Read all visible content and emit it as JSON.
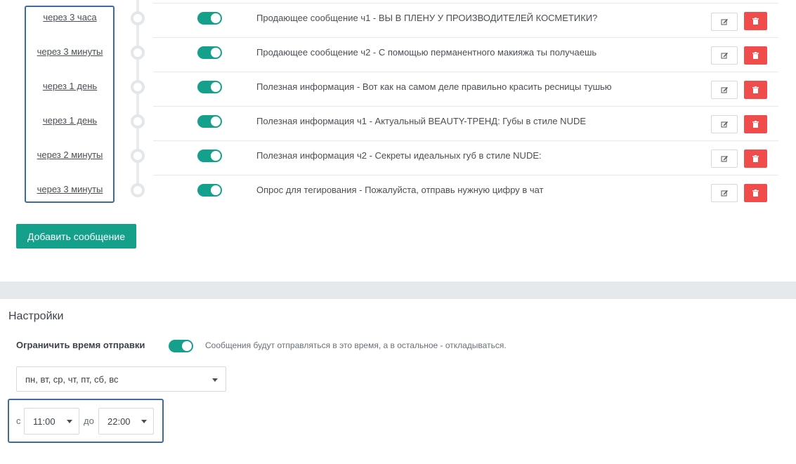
{
  "messages": [
    {
      "delay": "через 3 часа",
      "text": "Продающее сообщение ч1 - ВЫ В ПЛЕНУ У ПРОИЗВОДИТЕЛЕЙ КОСМЕТИКИ?",
      "enabled": true
    },
    {
      "delay": "через 3 минуты",
      "text": "Продающее сообщение ч2 - С помощью перманентного макияжа ты получаешь",
      "enabled": true
    },
    {
      "delay": "через 1 день",
      "text": "Полезная информация - Вот как на самом деле правильно красить ресницы тушью",
      "enabled": true
    },
    {
      "delay": "через 1 день",
      "text": "Полезная информация ч1 - Актуальный BEAUTY-ТРЕНД: Губы в стиле NUDE",
      "enabled": true
    },
    {
      "delay": "через 2 минуты",
      "text": "Полезная информация ч2 - Секреты идеальных губ в стиле NUDE:",
      "enabled": true
    },
    {
      "delay": "через 3 минуты",
      "text": "Опрос для тегирования - Пожалуйста, отправь нужную цифру в чат",
      "enabled": true
    }
  ],
  "icons": {
    "edit": "pencil-edit-icon",
    "delete": "trash-icon",
    "select": "caret-down-icon"
  },
  "add_button": "Добавить сообщение",
  "settings": {
    "title": "Настройки",
    "limit_label": "Ограничить время отправки",
    "limit_enabled": true,
    "limit_note": "Сообщения будут отправляться в это время, а в остальное - откладываться.",
    "days": "пн, вт, ср, чт, пт, сб, вс",
    "from_label": "с",
    "from_value": "11:00",
    "to_label": "до",
    "to_value": "22:00"
  },
  "colors": {
    "accent": "#14a08b",
    "danger": "#f04c4c",
    "highlight": "#3e6aa6"
  }
}
